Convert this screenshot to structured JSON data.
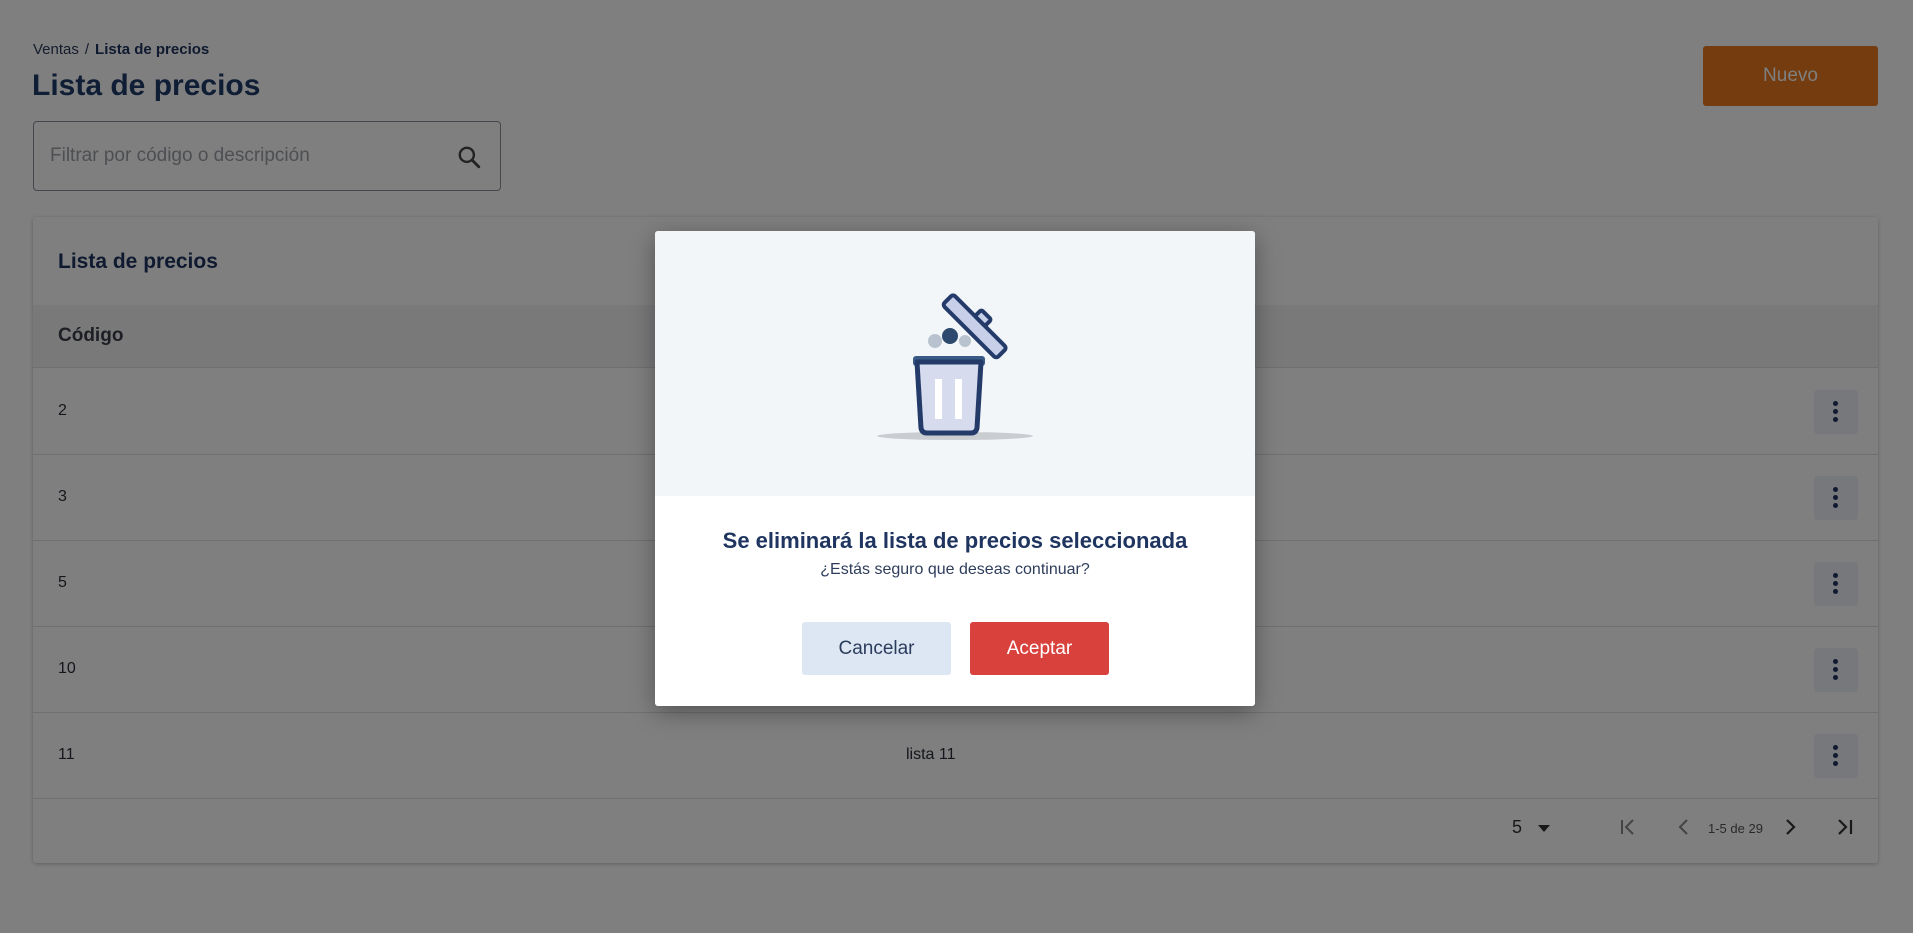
{
  "header": {
    "breadcrumb": [
      "Ventas",
      "Lista de precios"
    ],
    "breadcrumb_separator": "/",
    "title": "Lista de precios",
    "new_button_label": "Nuevo"
  },
  "search": {
    "placeholder": "Filtrar por código o descripción",
    "value": ""
  },
  "table": {
    "card_title": "Lista de precios",
    "columns": [
      "Código"
    ],
    "rows": [
      {
        "code": "2",
        "description": ""
      },
      {
        "code": "3",
        "description": ""
      },
      {
        "code": "5",
        "description": ""
      },
      {
        "code": "10",
        "description": ""
      },
      {
        "code": "11",
        "description": "lista 11"
      }
    ]
  },
  "pagination": {
    "rows_per_page": "5",
    "range_label": "1-5 de 29"
  },
  "dialog": {
    "title": "Se eliminará la lista de precios seleccionada",
    "message": "¿Estás seguro que deseas continuar?",
    "cancel_label": "Cancelar",
    "accept_label": "Aceptar",
    "illustration_icon": "trash-icon"
  },
  "colors": {
    "primary_accent": "#e8791f",
    "danger": "#d9413d",
    "brand_navy": "#1f3560",
    "cancel_bg": "#dde7f3"
  }
}
